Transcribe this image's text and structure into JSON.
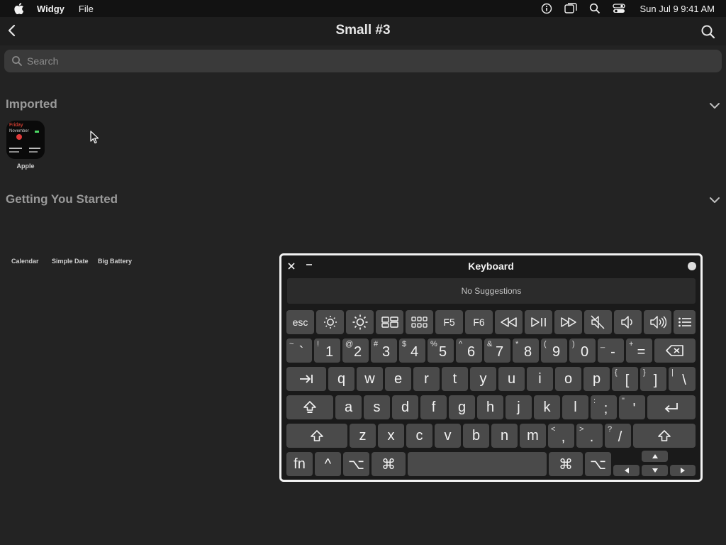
{
  "menubar": {
    "app_name": "Widgy",
    "file_menu": "File",
    "clock": "Sun Jul 9  9:41 AM"
  },
  "titlebar": {
    "title": "Small #3"
  },
  "search": {
    "placeholder": "Search"
  },
  "sections": {
    "imported": "Imported",
    "getting_started": "Getting You Started"
  },
  "imported_widget": {
    "label": "Apple",
    "day": "Friday",
    "month": "November"
  },
  "starter_widgets": [
    "Calendar",
    "Simple Date",
    "Big Battery"
  ],
  "keyboard": {
    "title": "Keyboard",
    "suggestions": "No Suggestions",
    "fn_row": [
      "esc",
      "F5",
      "F6"
    ],
    "number_row": [
      {
        "sub": "~",
        "main": "`"
      },
      {
        "sub": "!",
        "main": "1"
      },
      {
        "sub": "@",
        "main": "2"
      },
      {
        "sub": "#",
        "main": "3"
      },
      {
        "sub": "$",
        "main": "4"
      },
      {
        "sub": "%",
        "main": "5"
      },
      {
        "sub": "^",
        "main": "6"
      },
      {
        "sub": "&",
        "main": "7"
      },
      {
        "sub": "*",
        "main": "8"
      },
      {
        "sub": "(",
        "main": "9"
      },
      {
        "sub": ")",
        "main": "0"
      },
      {
        "sub": "_",
        "main": "-"
      },
      {
        "sub": "+",
        "main": "="
      }
    ],
    "row_q": [
      "q",
      "w",
      "e",
      "r",
      "t",
      "y",
      "u",
      "i",
      "o",
      "p"
    ],
    "row_q_punct": [
      {
        "sub": "{",
        "main": "["
      },
      {
        "sub": "}",
        "main": "]"
      },
      {
        "sub": "|",
        "main": "\\"
      }
    ],
    "row_a": [
      "a",
      "s",
      "d",
      "f",
      "g",
      "h",
      "j",
      "k",
      "l"
    ],
    "row_a_punct": [
      {
        "sub": ":",
        "main": ";"
      },
      {
        "sub": "\"",
        "main": "'"
      }
    ],
    "row_z": [
      "z",
      "x",
      "c",
      "v",
      "b",
      "n",
      "m"
    ],
    "row_z_punct": [
      {
        "sub": "<",
        "main": ","
      },
      {
        "sub": ">",
        "main": "."
      },
      {
        "sub": "?",
        "main": "/"
      }
    ],
    "bottom": {
      "fn": "fn",
      "ctrl": "^",
      "opt": "⌥",
      "cmd": "⌘"
    }
  }
}
